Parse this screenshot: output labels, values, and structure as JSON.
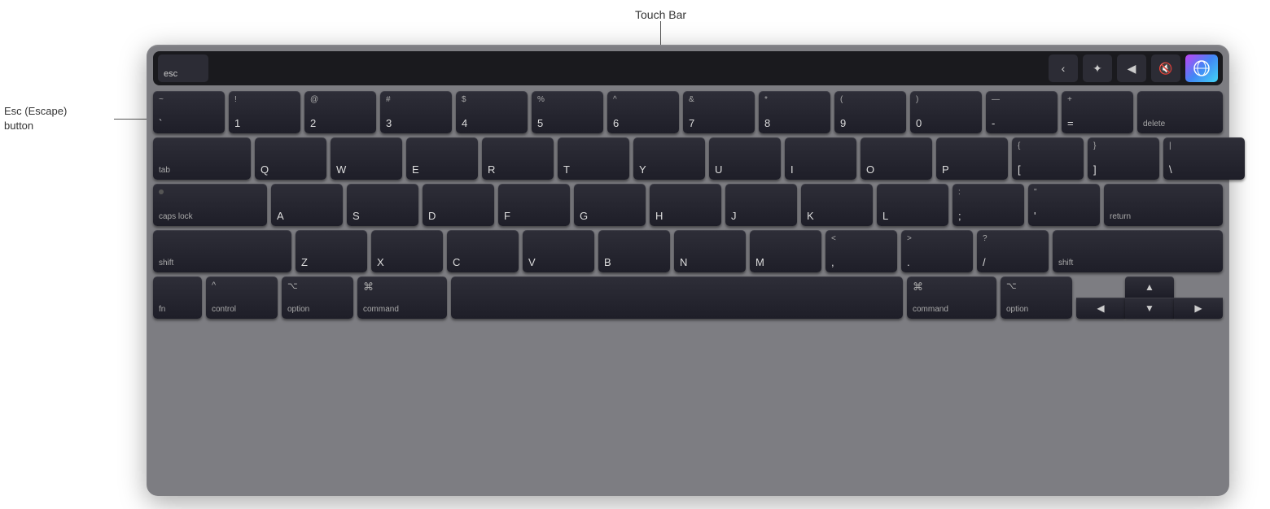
{
  "annotations": {
    "touch_bar_label": "Touch Bar",
    "esc_label": "Esc (Escape)\nbutton"
  },
  "touch_bar": {
    "esc": "esc",
    "controls": [
      "‹",
      "☀",
      "◀",
      "🔇",
      "Siri"
    ]
  },
  "rows": {
    "r1": {
      "keys": [
        {
          "top": "~",
          "bot": "\\`",
          "label": ""
        },
        {
          "top": "!",
          "bot": "1",
          "label": ""
        },
        {
          "top": "@",
          "bot": "2",
          "label": ""
        },
        {
          "top": "#",
          "bot": "3",
          "label": ""
        },
        {
          "top": "$",
          "bot": "4",
          "label": ""
        },
        {
          "top": "%",
          "bot": "5",
          "label": ""
        },
        {
          "top": "^",
          "bot": "6",
          "label": ""
        },
        {
          "top": "&",
          "bot": "7",
          "label": ""
        },
        {
          "top": "*",
          "bot": "8",
          "label": ""
        },
        {
          "top": "(",
          "bot": "9",
          "label": ""
        },
        {
          "top": ")",
          "bot": "0",
          "label": ""
        },
        {
          "top": "—",
          "bot": "-",
          "label": ""
        },
        {
          "top": "+",
          "bot": "=",
          "label": ""
        },
        {
          "top": "",
          "bot": "",
          "label": "delete"
        }
      ]
    }
  },
  "labels": {
    "tab": "tab",
    "caps_lock": "caps lock",
    "shift": "shift",
    "fn": "fn",
    "control": "control",
    "option_l": "option",
    "command_l": "command",
    "command_r": "command",
    "option_r": "option",
    "return": "return",
    "delete": "delete"
  }
}
